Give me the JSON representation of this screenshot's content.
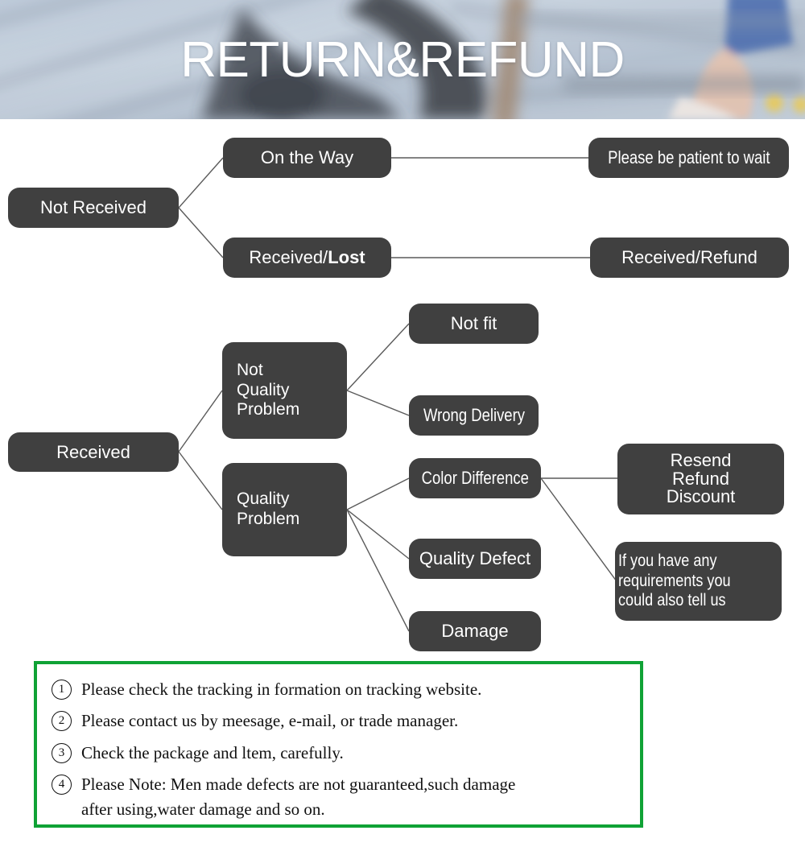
{
  "header": {
    "title": "RETURN&REFUND",
    "photo_description": "blurred-skateboard-deck-photo",
    "title_color": "#ffffff"
  },
  "flowchart": {
    "node_color": "#404040",
    "text_color": "#ffffff",
    "line_color": "#555555",
    "branch_not_received": {
      "root": "Not Received",
      "children": [
        {
          "label": "On the Way",
          "result": "Please be patient to wait"
        },
        {
          "label_a": "Received/",
          "label_b": "Lost",
          "result": "Received/Refund"
        }
      ]
    },
    "branch_received": {
      "root": "Received",
      "categories": [
        {
          "label_lines": [
            "Not",
            "Quality",
            "Problem"
          ],
          "items": [
            "Not fit",
            "Wrong Delivery"
          ]
        },
        {
          "label_lines": [
            "Quality",
            "Problem"
          ],
          "items": [
            "Color Difference",
            "Quality Defect",
            "Damage"
          ]
        }
      ],
      "outcomes": [
        {
          "lines": [
            "Resend",
            "Refund",
            "Discount"
          ]
        },
        {
          "lines": [
            "If you have any",
            "requirements you",
            "could also tell us"
          ]
        }
      ]
    }
  },
  "notes": {
    "border_color": "#0fa235",
    "items": [
      {
        "num": "1",
        "text": "Please check the tracking in formation on tracking website.",
        "cont": ""
      },
      {
        "num": "2",
        "text": "Please contact us by meesage, e-mail, or trade manager.",
        "cont": ""
      },
      {
        "num": "3",
        "text": "Check the package and ltem, carefully.",
        "cont": ""
      },
      {
        "num": "4",
        "text": "Please Note: Men made defects  are not guaranteed,such damage",
        "cont": "after using,water damage and so on."
      }
    ]
  }
}
